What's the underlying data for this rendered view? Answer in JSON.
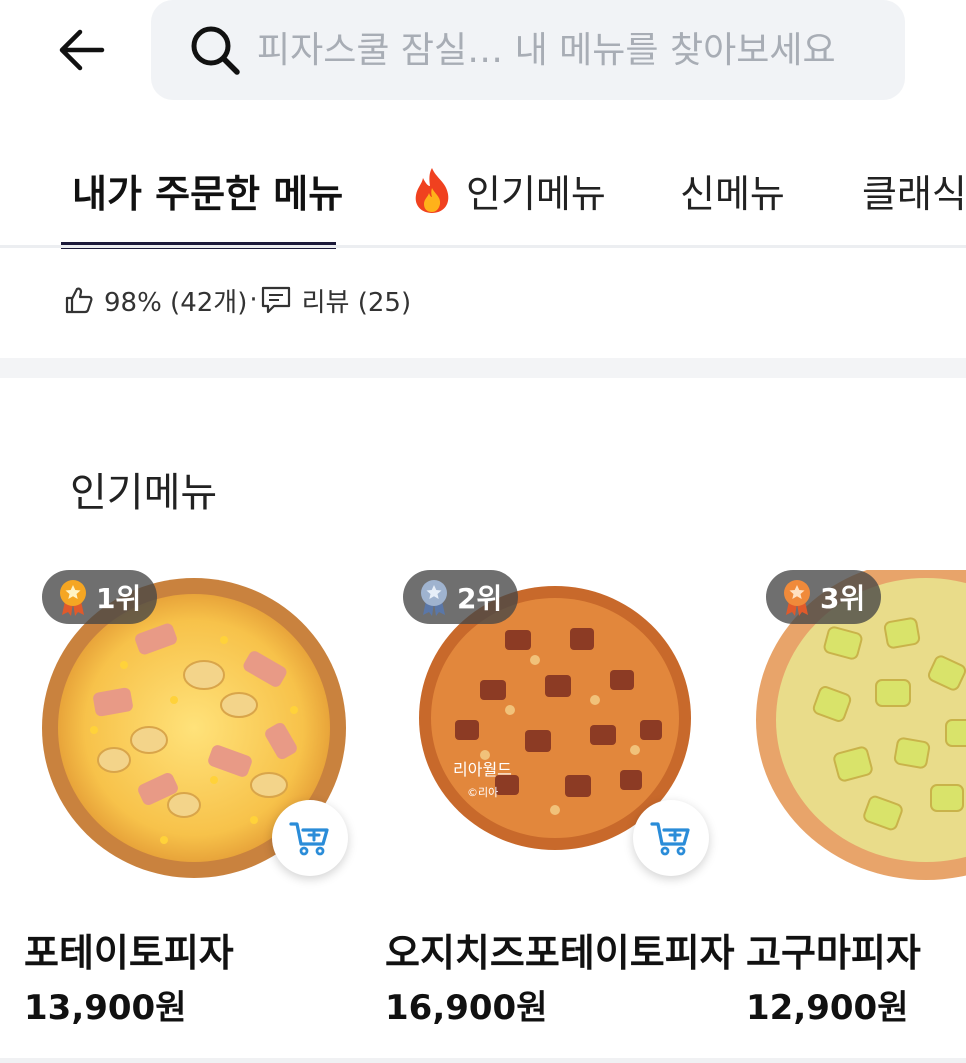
{
  "search": {
    "placeholder": "피자스쿨 잠실… 내 메뉴를 찾아보세요"
  },
  "tabs": [
    {
      "label": "내가 주문한 메뉴",
      "active": true
    },
    {
      "label": "인기메뉴",
      "icon": "fire-icon",
      "active": false
    },
    {
      "label": "신메뉴",
      "active": false
    },
    {
      "label": "클래식",
      "active": false
    }
  ],
  "stats": {
    "like_text": "98% (42개)",
    "separator": "·",
    "review_text": "리뷰 (25)"
  },
  "popular": {
    "title": "인기메뉴",
    "items": [
      {
        "rank": "1위",
        "medal": "gold-medal-icon",
        "name": "포테이토피자",
        "price": "13,900원"
      },
      {
        "rank": "2위",
        "medal": "silver-medal-icon",
        "name": "오지치즈포테이토피자",
        "price": "16,900원",
        "watermark": "리아월드",
        "watermark_sub": "©리아"
      },
      {
        "rank": "3위",
        "medal": "bronze-medal-icon",
        "name": "고구마피자",
        "price": "12,900원"
      }
    ]
  },
  "colors": {
    "accent_underline": "#1c1a3a",
    "cart_icon": "#2a8cd8",
    "search_bg": "#f1f3f6"
  }
}
